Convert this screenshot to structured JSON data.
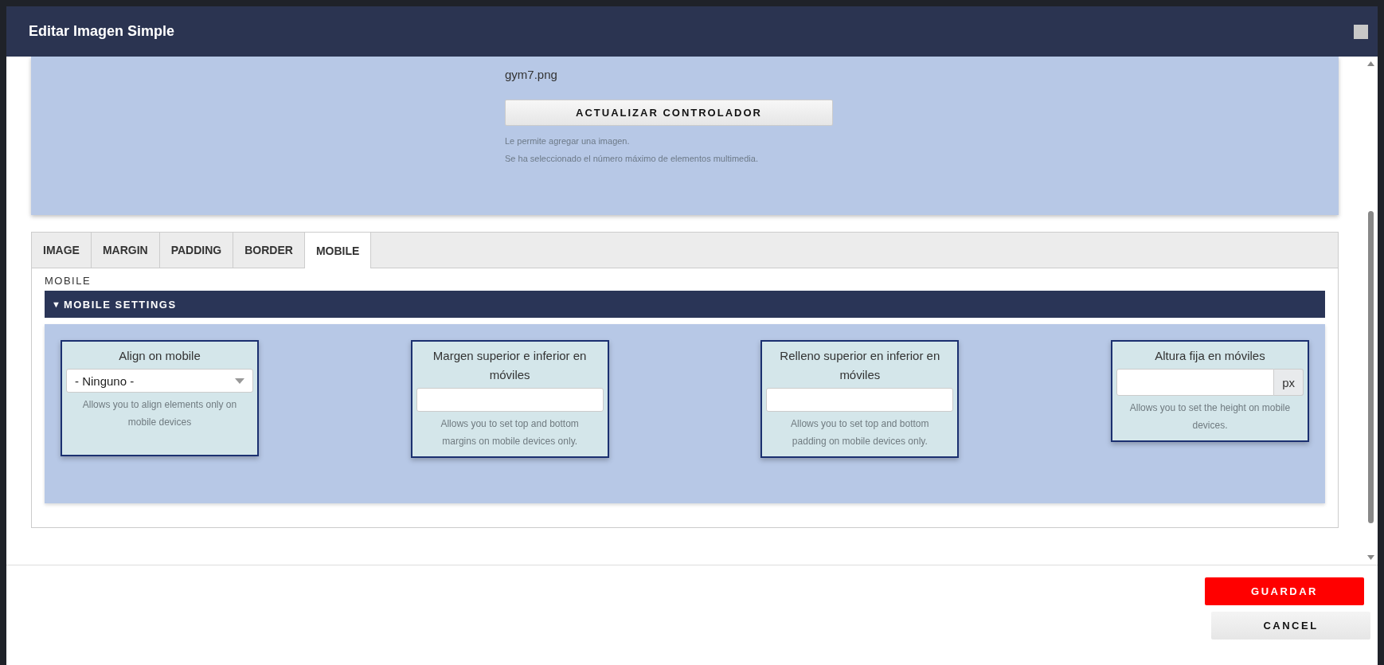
{
  "dialog": {
    "title": "Editar Imagen Simple"
  },
  "media": {
    "filename": "gym7.png",
    "button": "ACTUALIZAR CONTROLADOR",
    "help": [
      "Le permite agregar una imagen.",
      "Se ha seleccionado el número máximo de elementos multimedia."
    ]
  },
  "tabs": [
    {
      "label": "IMAGE",
      "selected": false
    },
    {
      "label": "MARGIN",
      "selected": false
    },
    {
      "label": "PADDING",
      "selected": false
    },
    {
      "label": "BORDER",
      "selected": false
    },
    {
      "label": "MOBILE",
      "selected": true
    }
  ],
  "section_label": "MOBILE",
  "panel": {
    "toggle": "▼",
    "title": "MOBILE SETTINGS",
    "expanded": true
  },
  "settings": [
    {
      "kind": "select",
      "label": "Align on mobile",
      "value": "- Ninguno -",
      "help": "Allows you to align elements only on mobile devices"
    },
    {
      "kind": "text",
      "label": "Margen superior e inferior en móviles",
      "help": "Allows you to set top and bottom margins on mobile devices only."
    },
    {
      "kind": "text",
      "label": "Relleno superior en inferior en móviles",
      "help": "Allows you to set top and bottom padding on mobile devices only."
    },
    {
      "kind": "unit",
      "label": "Altura fija en móviles",
      "unit": "px",
      "help": "Allows you to set the height on mobile devices."
    }
  ],
  "buttons": [
    {
      "label": "GUARDAR",
      "kind": "primary"
    },
    {
      "label": "CANCEL",
      "kind": "secondary"
    }
  ]
}
